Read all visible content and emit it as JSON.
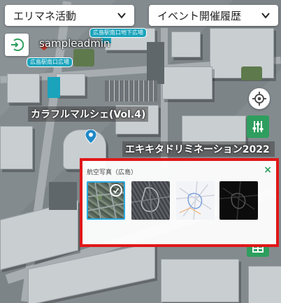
{
  "selects": {
    "area": {
      "value": "エリマネ活動"
    },
    "history": {
      "value": "イベント開催履歴"
    }
  },
  "user": {
    "name": "sampleadmin"
  },
  "map": {
    "tags": [
      "広島駅南口地下広場",
      "広島駅南口広場"
    ],
    "labels": {
      "event1": "カラフルマルシェ(Vol.4)",
      "event2": "エキキタドリミネーション2022"
    }
  },
  "layer_panel": {
    "title": "航空写真（広島）",
    "close": "×",
    "options": [
      {
        "name": "aerial",
        "selected": true
      },
      {
        "name": "dark-satellite",
        "selected": false
      },
      {
        "name": "street-light",
        "selected": false
      },
      {
        "name": "street-dark",
        "selected": false
      }
    ]
  },
  "colors": {
    "accent_green": "#2e9e5e",
    "highlight_red": "#e01818",
    "selection_blue": "#2aa9e0",
    "tag_teal": "#1aa3bb"
  },
  "icons": [
    "chevron-down-icon",
    "login-icon",
    "locate-icon",
    "filter-icon",
    "map-pin-icon",
    "check-icon",
    "close-icon",
    "layers-icon"
  ]
}
